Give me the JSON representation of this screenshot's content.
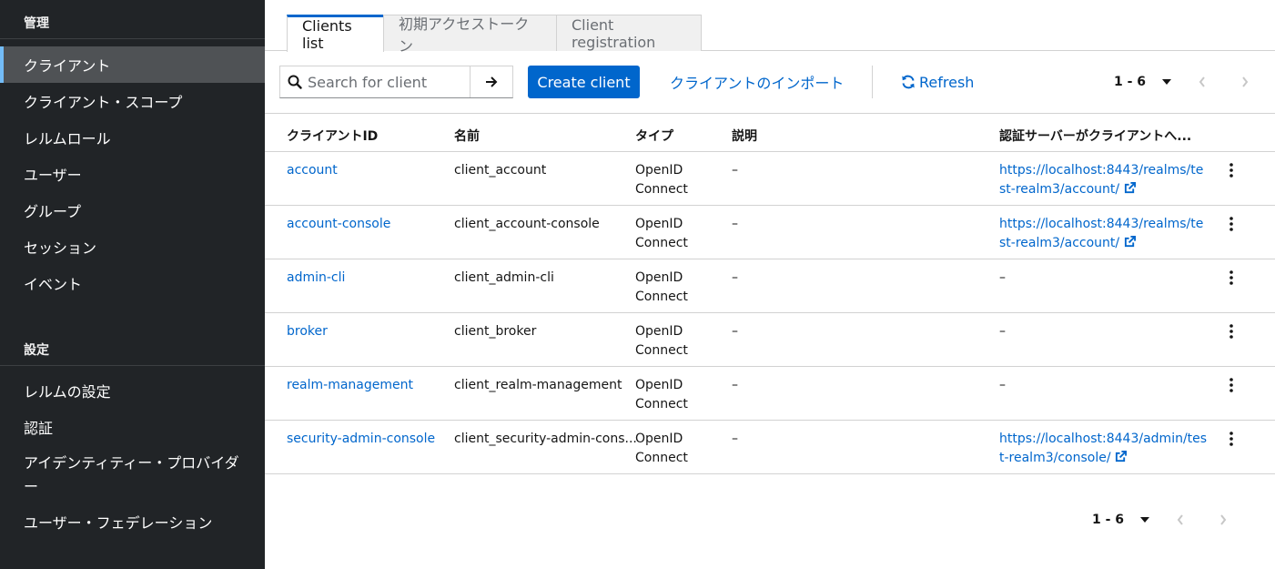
{
  "sidebar": {
    "section_manage": "管理",
    "manage_items": [
      {
        "label": "クライアント",
        "active": true
      },
      {
        "label": "クライアント・スコープ"
      },
      {
        "label": "レルムロール"
      },
      {
        "label": "ユーザー"
      },
      {
        "label": "グループ"
      },
      {
        "label": "セッション"
      },
      {
        "label": "イベント"
      }
    ],
    "section_configure": "設定",
    "configure_items": [
      {
        "label": "レルムの設定"
      },
      {
        "label": "認証"
      },
      {
        "label": "アイデンティティー・プロバイダー"
      },
      {
        "label": "ユーザー・フェデレーション"
      }
    ]
  },
  "tabs": [
    {
      "label": "Clients list",
      "active": true
    },
    {
      "label": "初期アクセストークン"
    },
    {
      "label": "Client registration"
    }
  ],
  "toolbar": {
    "search_placeholder": "Search for client",
    "create_label": "Create client",
    "import_label": "クライアントのインポート",
    "refresh_label": "Refresh"
  },
  "pagination": {
    "top_label": "1 - 6",
    "bottom_label": "1 - 6"
  },
  "table": {
    "headers": [
      "クライアントID",
      "名前",
      "タイプ",
      "説明",
      "認証サーバーがクライアントへ..."
    ],
    "rows": [
      {
        "client_id": "account",
        "name": "client_account",
        "type": "OpenID Connect",
        "description": "–",
        "url": "https://localhost:8443/realms/test-realm3/account/"
      },
      {
        "client_id": "account-console",
        "name": "client_account-console",
        "type": "OpenID Connect",
        "description": "–",
        "url": "https://localhost:8443/realms/test-realm3/account/"
      },
      {
        "client_id": "admin-cli",
        "name": "client_admin-cli",
        "type": "OpenID Connect",
        "description": "–",
        "url": "–"
      },
      {
        "client_id": "broker",
        "name": "client_broker",
        "type": "OpenID Connect",
        "description": "–",
        "url": "–"
      },
      {
        "client_id": "realm-management",
        "name": "client_realm-management",
        "type": "OpenID Connect",
        "description": "–",
        "url": "–"
      },
      {
        "client_id": "security-admin-console",
        "name": "client_security-admin-cons...",
        "type": "OpenID Connect",
        "description": "–",
        "url": "https://localhost:8443/admin/test-realm3/console/"
      }
    ]
  },
  "colors": {
    "primary": "#0066cc",
    "sidebar_bg": "#212427",
    "active_item_bg": "#4f5255",
    "active_accent": "#73bcf7"
  },
  "icons": {
    "search": "search-icon",
    "arrow": "arrow-right-icon",
    "refresh": "sync-icon",
    "external": "external-link-icon",
    "kebab": "kebab-icon",
    "caret": "caret-down-icon",
    "prev": "angle-left-icon",
    "next": "angle-right-icon"
  }
}
